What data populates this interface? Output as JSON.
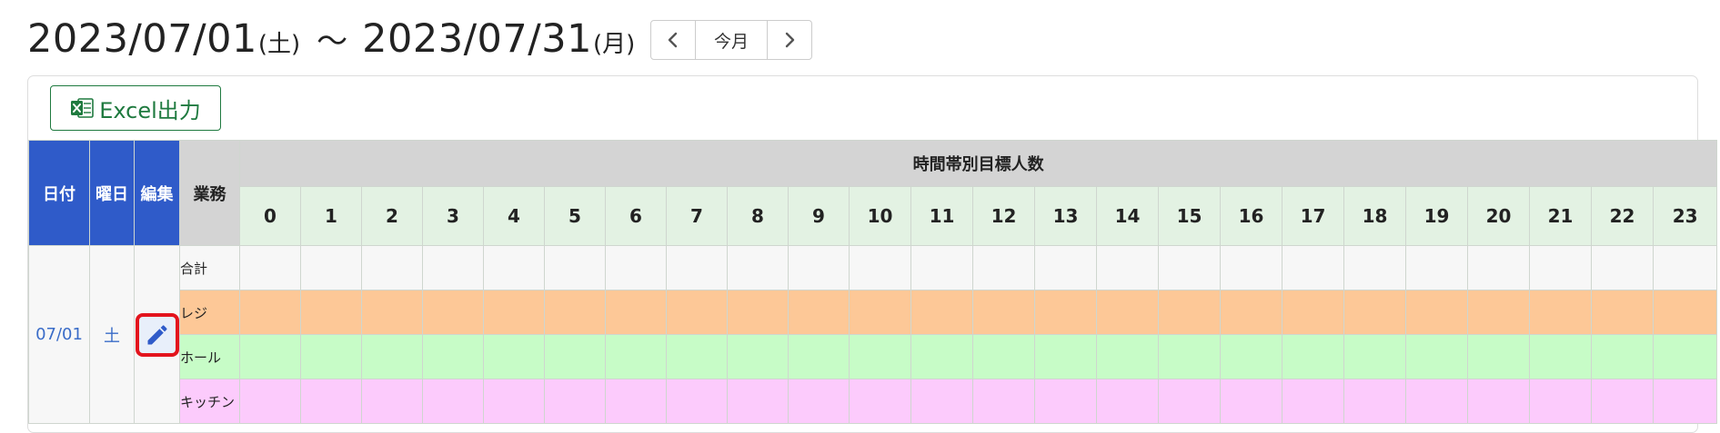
{
  "period": {
    "start_date": "2023/07/01",
    "start_dow": "(土)",
    "separator": "〜",
    "end_date": "2023/07/31",
    "end_dow": "(月)"
  },
  "nav": {
    "prev_icon": "chevron-left-icon",
    "today_label": "今月",
    "next_icon": "chevron-right-icon"
  },
  "toolbar": {
    "excel_label": "Excel出力",
    "excel_icon": "excel-icon"
  },
  "table": {
    "headers": {
      "date": "日付",
      "dow": "曜日",
      "edit": "編集",
      "task": "業務",
      "group": "時間帯別目標人数"
    },
    "hours": [
      "0",
      "1",
      "2",
      "3",
      "4",
      "5",
      "6",
      "7",
      "8",
      "9",
      "10",
      "11",
      "12",
      "13",
      "14",
      "15",
      "16",
      "17",
      "18",
      "19",
      "20",
      "21",
      "22",
      "23"
    ],
    "rows": [
      {
        "date": "07/01",
        "dow": "土",
        "edit_icon": "pencil-icon",
        "tasks": [
          {
            "name": "合計",
            "color": "#f7f7f7"
          },
          {
            "name": "レジ",
            "color": "#fdc897"
          },
          {
            "name": "ホール",
            "color": "#c7fcc7"
          },
          {
            "name": "キッチン",
            "color": "#fccbfc"
          }
        ]
      }
    ]
  },
  "colors": {
    "header_blue": "#2f5bc9",
    "header_gray": "#d4d4d4",
    "hour_header": "#e3f2e3",
    "excel_green": "#1f7a3f",
    "highlight_red": "#e3141d"
  }
}
